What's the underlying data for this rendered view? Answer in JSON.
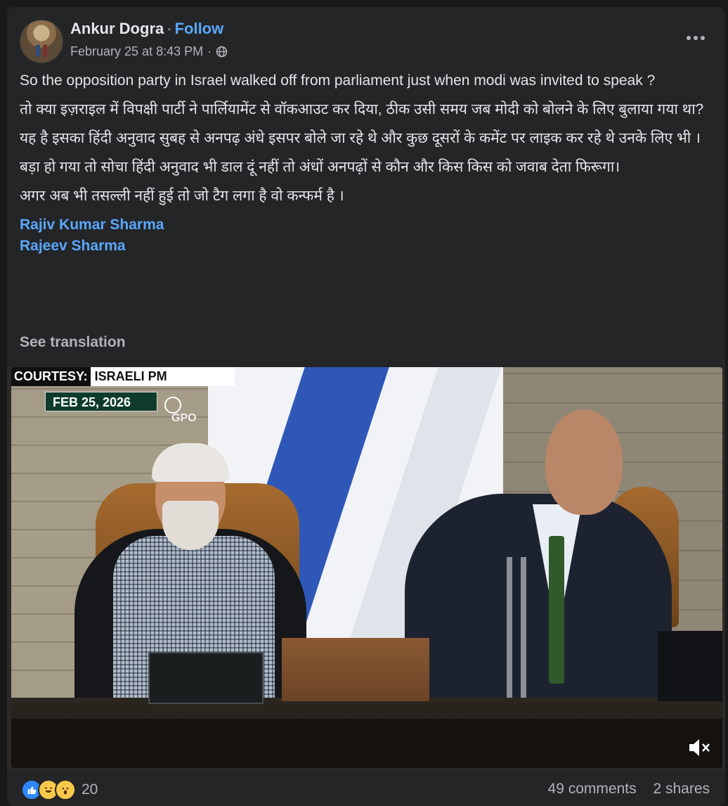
{
  "post": {
    "author": "Ankur Dogra",
    "separator": "·",
    "follow_label": "Follow",
    "timestamp": "February 25 at 8:43 PM",
    "timestamp_separator": "·",
    "paragraphs": [
      "So the opposition party in Israel walked off from parliament just when modi was invited to speak ?",
      "तो क्या इज़राइल में विपक्षी पार्टी ने पार्लियामेंट से वॉकआउट कर दिया, ठीक उसी समय जब मोदी को बोलने के लिए बुलाया गया था?",
      "यह है इसका हिंदी अनुवाद सुबह से अनपढ़ अंधे इसपर बोले जा रहे थे और कुछ दूसरों के कमेंट पर लाइक कर रहे थे उनके लिए भी ।",
      "बड़ा हो गया तो सोचा हिंदी अनुवाद भी डाल दूं नहीं तो अंधों अनपढ़ों से कौन और किस किस को जवाब देता फिरूगा।",
      "अगर अब भी तसल्ली नहीं हुई तो जो टैग लगा है वो कन्फर्म है ।"
    ],
    "tags": [
      "Rajiv Kumar Sharma",
      "Rajeev Sharma"
    ],
    "see_translation": "See translation"
  },
  "video": {
    "courtesy_label": "COURTESY:",
    "courtesy_source": "ISRAELI PM",
    "date": "FEB 25, 2026",
    "watermark": "GPO",
    "mute_icon": "speaker-muted-icon"
  },
  "footer": {
    "reaction_count": "20",
    "comments": "49 comments",
    "shares": "2 shares",
    "reactions": [
      "like",
      "haha",
      "wow"
    ]
  },
  "colors": {
    "background": "#18191a",
    "card": "#242526",
    "link": "#5aa7ff",
    "muted_text": "#b0b3b8"
  }
}
